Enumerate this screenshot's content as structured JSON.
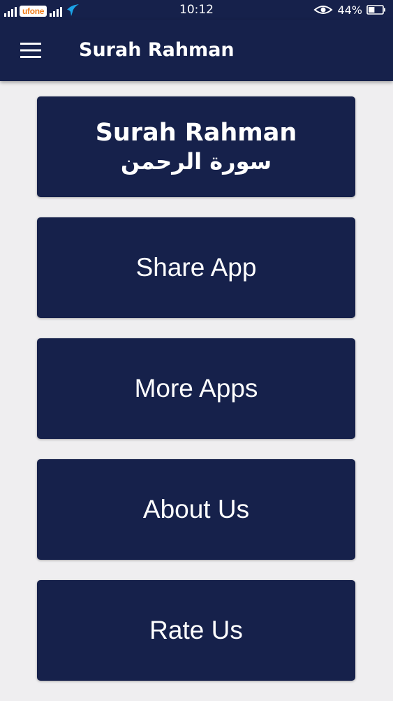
{
  "status_bar": {
    "carrier_name": "ufone",
    "time": "10:12",
    "battery_percent": "44%",
    "battery_level": 0.44,
    "carrier_color": "#f07d1a",
    "telenor_color": "#1ba3e8"
  },
  "app_bar": {
    "title": "Surah Rahman",
    "menu_icon": "hamburger-menu-icon"
  },
  "menu": {
    "surah_card": {
      "title_en": "Surah Rahman",
      "title_ar": "سورة الرحمن"
    },
    "share_app": "Share App",
    "more_apps": "More Apps",
    "about_us": "About Us",
    "rate_us": "Rate Us"
  },
  "colors": {
    "primary": "#16214b",
    "background": "#efeef0",
    "text_on_primary": "#ffffff"
  }
}
